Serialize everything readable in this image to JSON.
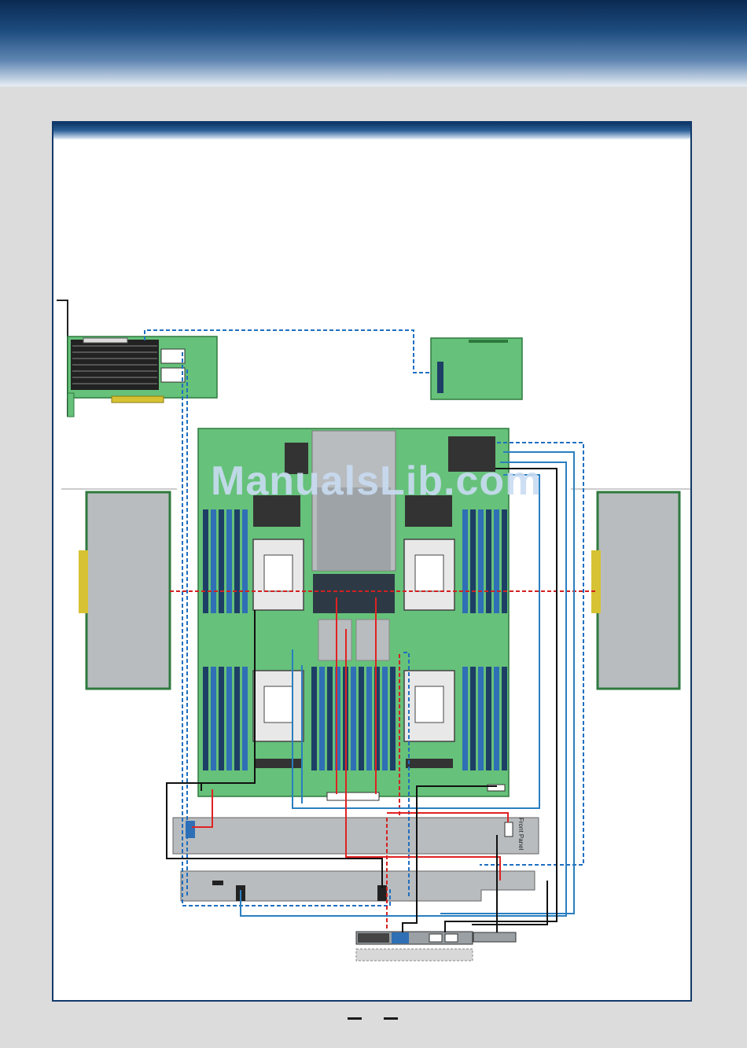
{
  "watermark": "ManualsLib.com",
  "front_panel_label": "Front Panel",
  "colors": {
    "header_dark": "#0b2a52",
    "frame_border": "#123a6b",
    "board_green": "#66c17a",
    "board_outline": "#2e7a3e",
    "heatsink_gray": "#b8bcbf",
    "dimm_blue": "#2f6fb5",
    "dimm_dark": "#1d3f66",
    "cable_blue": "#2a7fc0",
    "cable_red": "#e02222",
    "cable_black": "#111111",
    "dashed_blue": "#1f6fc0",
    "dashed_red": "#d42020"
  },
  "icons": [
    "pcie-raid-card",
    "raid-maintenance-module",
    "motherboard",
    "cpu-socket",
    "dimm-slot",
    "riser-card",
    "backplane",
    "front-io-panel",
    "vga-connector",
    "usb-connector"
  ]
}
